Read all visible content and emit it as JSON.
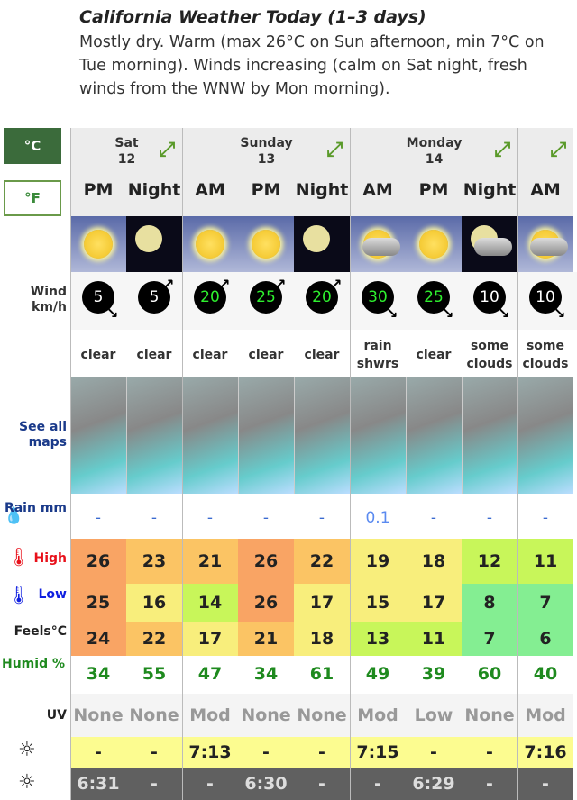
{
  "header": {
    "title": "California Weather Today (1–3 days)",
    "description": "Mostly dry. Warm (max 26°C on Sun afternoon, min 7°C on Tue morning). Winds increasing (calm on Sat night, fresh winds from the WNW by Mon morning)."
  },
  "units": {
    "celsius": "°C",
    "fahrenheit": "°F",
    "selected": "°C"
  },
  "days": [
    {
      "name": "Sat",
      "date": "12",
      "span": 2
    },
    {
      "name": "Sunday",
      "date": "13",
      "span": 3
    },
    {
      "name": "Monday",
      "date": "14",
      "span": 3
    },
    {
      "name": "",
      "date": "",
      "span": 1
    }
  ],
  "labels": {
    "wind": "Wind km/h",
    "maps": "See all maps",
    "rain": "Rain mm",
    "high": "High",
    "low": "Low",
    "feels": "Feels°C",
    "humid": "Humid %",
    "uv": "UV"
  },
  "periods": [
    {
      "period": "PM",
      "icon": "sun",
      "wind": "5",
      "wind_dir": "down",
      "cond": "clear",
      "rain": "-",
      "high": "26",
      "low": "25",
      "feels": "24",
      "humid": "34",
      "uv": "None",
      "sunrise": "-",
      "sunset": "6:31"
    },
    {
      "period": "Night",
      "icon": "moon",
      "wind": "5",
      "wind_dir": "up",
      "cond": "clear",
      "rain": "-",
      "high": "23",
      "low": "16",
      "feels": "22",
      "humid": "55",
      "uv": "None",
      "sunrise": "-",
      "sunset": "-"
    },
    {
      "period": "AM",
      "icon": "sun",
      "wind": "20",
      "wind_dir": "up",
      "cond": "clear",
      "rain": "-",
      "high": "21",
      "low": "14",
      "feels": "17",
      "humid": "47",
      "uv": "Mod",
      "sunrise": "7:13",
      "sunset": "-"
    },
    {
      "period": "PM",
      "icon": "sun",
      "wind": "25",
      "wind_dir": "up",
      "cond": "clear",
      "rain": "-",
      "high": "26",
      "low": "26",
      "feels": "21",
      "humid": "34",
      "uv": "None",
      "sunrise": "-",
      "sunset": "6:30"
    },
    {
      "period": "Night",
      "icon": "moon",
      "wind": "20",
      "wind_dir": "up",
      "cond": "clear",
      "rain": "-",
      "high": "22",
      "low": "17",
      "feels": "18",
      "humid": "61",
      "uv": "None",
      "sunrise": "-",
      "sunset": "-"
    },
    {
      "period": "AM",
      "icon": "rain-showers",
      "wind": "30",
      "wind_dir": "down",
      "cond": "rain shwrs",
      "rain": "0.1",
      "high": "19",
      "low": "15",
      "feels": "13",
      "humid": "49",
      "uv": "Mod",
      "sunrise": "7:15",
      "sunset": "-"
    },
    {
      "period": "PM",
      "icon": "sun",
      "wind": "25",
      "wind_dir": "down",
      "cond": "clear",
      "rain": "-",
      "high": "18",
      "low": "17",
      "feels": "11",
      "humid": "39",
      "uv": "Low",
      "sunrise": "-",
      "sunset": "6:29"
    },
    {
      "period": "Night",
      "icon": "moon-cloud",
      "wind": "10",
      "wind_dir": "down",
      "cond": "some clouds",
      "rain": "-",
      "high": "12",
      "low": "8",
      "feels": "7",
      "humid": "60",
      "uv": "None",
      "sunrise": "-",
      "sunset": "-"
    },
    {
      "period": "AM",
      "icon": "sun-cloud",
      "wind": "10",
      "wind_dir": "down",
      "cond": "some clouds",
      "rain": "-",
      "high": "11",
      "low": "7",
      "feels": "6",
      "humid": "40",
      "uv": "Mod",
      "sunrise": "7:16",
      "sunset": "-"
    }
  ],
  "colors": {
    "hot": "#f9a464",
    "warm": "#fbc464",
    "mild": "#f8ee7c",
    "cool": "#c8f65a",
    "cold": "#84ee92",
    "humid": "#1e8a1e",
    "high": "#e8101a",
    "low": "#1020e0",
    "sunrise_bg": "#fcfc90",
    "sunset_bg": "#606060"
  }
}
